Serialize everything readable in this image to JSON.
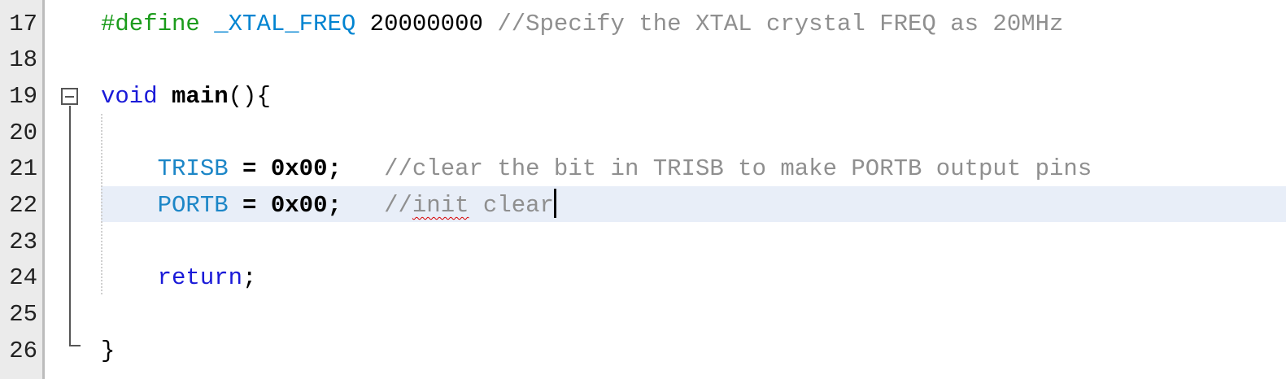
{
  "editor": {
    "line_numbers": [
      "17",
      "18",
      "19",
      "20",
      "21",
      "22",
      "23",
      "24",
      "25",
      "26"
    ],
    "current_line": "22",
    "lines": {
      "l17": {
        "directive": "#define",
        "macro": "_XTAL_FREQ",
        "value": "20000000",
        "comment": "//Specify the XTAL crystal FREQ as 20MHz"
      },
      "l19": {
        "keyword": "void",
        "name": "main",
        "punct": "(){"
      },
      "l21": {
        "var": "TRISB",
        "assign": "=",
        "value": "0x00;",
        "comment": "//clear the bit in TRISB to make PORTB output pins"
      },
      "l22": {
        "var": "PORTB",
        "assign": "=",
        "value": "0x00;",
        "comment_start": "//",
        "comment_misspelled": "init",
        "comment_rest": " clear"
      },
      "l24": {
        "keyword": "return",
        "punct": ";"
      },
      "l26": {
        "punct": "}"
      }
    }
  },
  "colors": {
    "preprocessor": "#1c9c1c",
    "macro": "#0084d1",
    "comment": "#8f8f8f",
    "keyword": "#1a1ad8",
    "variable": "#1c86c7",
    "current_line_bg": "#e8eef8",
    "gutter_bg": "#ebebeb",
    "spell_error": "#d90000"
  },
  "icons": {
    "fold_toggle": "fold-collapse-icon"
  }
}
